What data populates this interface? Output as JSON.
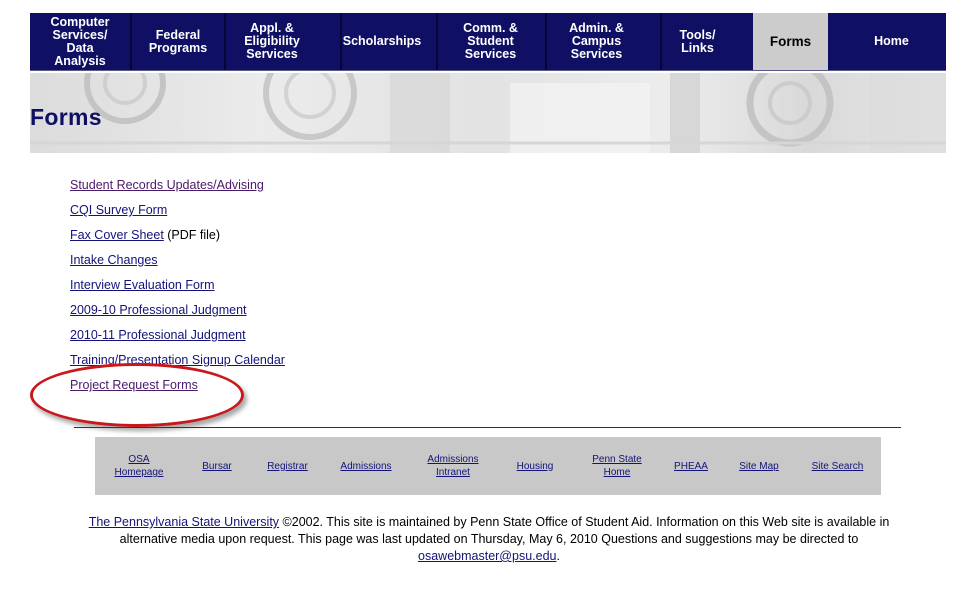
{
  "nav": {
    "items": [
      {
        "label": "Computer\nServices/\nData\nAnalysis"
      },
      {
        "label": "Federal\nPrograms"
      },
      {
        "label": "Appl. &\nEligibility\nServices"
      },
      {
        "label": "Scholarships"
      },
      {
        "label": "Comm. &\nStudent\nServices"
      },
      {
        "label": "Admin. &\nCampus\nServices"
      },
      {
        "label": "Tools/\nLinks"
      },
      {
        "label": "Forms"
      },
      {
        "label": "Home"
      }
    ],
    "active": "Forms",
    "color": "#0f1064"
  },
  "page": {
    "title": "Forms"
  },
  "links": [
    {
      "label": "Student Records Updates/Advising",
      "note": ""
    },
    {
      "label": "CQI Survey Form",
      "note": ""
    },
    {
      "label": "Fax Cover Sheet",
      "note": " (PDF file)"
    },
    {
      "label": "Intake Changes",
      "note": ""
    },
    {
      "label": "Interview Evaluation Form",
      "note": ""
    },
    {
      "label": "2009-10 Professional Judgment",
      "note": ""
    },
    {
      "label": "2010-11 Professional Judgment",
      "note": ""
    },
    {
      "label": "Training/Presentation Signup Calendar",
      "note": ""
    },
    {
      "label": "Project Request Forms",
      "note": ""
    }
  ],
  "footer_nav": [
    {
      "label": "OSA\nHomepage"
    },
    {
      "label": "Bursar"
    },
    {
      "label": "Registrar"
    },
    {
      "label": "Admissions"
    },
    {
      "label": "Admissions\nIntranet"
    },
    {
      "label": "Housing"
    },
    {
      "label": "Penn State\nHome"
    },
    {
      "label": "PHEAA"
    },
    {
      "label": "Site Map"
    },
    {
      "label": "Site Search"
    }
  ],
  "footer": {
    "university_link": "The Pennsylvania State University",
    "text": " ©2002. This site is maintained by Penn State Office of Student Aid. Information on this Web site is available in alternative media upon request. This page was last updated on Thursday, May 6, 2010 Questions and suggestions may be directed to ",
    "email": "osawebmaster@psu.edu",
    "end": "."
  },
  "colors": {
    "highlight": "#c8181c",
    "link": "#13137a"
  }
}
